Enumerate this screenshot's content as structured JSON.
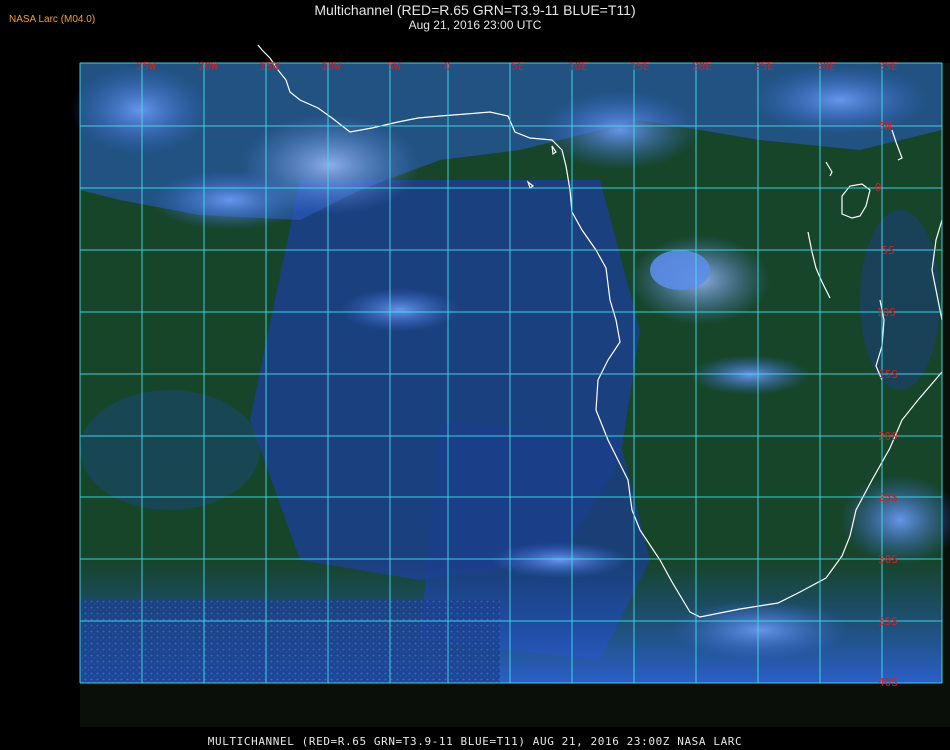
{
  "header": {
    "producer": "NASA Larc (M04.0)",
    "title": "Multichannel (RED=R.65 GRN=T3.9-11 BLUE=T11)",
    "datetime": "Aug 21, 2016 23:00 UTC"
  },
  "footer": {
    "caption": "MULTICHANNEL (RED=R.65 GRN=T3.9-11 BLUE=T11) AUG 21, 2016 23:00Z   NASA LARC"
  },
  "map": {
    "longitude_labels": [
      "25W",
      "20W",
      "15W",
      "10W",
      "5W",
      "0",
      "5E",
      "10E",
      "15E",
      "20E",
      "25E",
      "30E",
      "35E"
    ],
    "latitude_labels": [
      "5N",
      "0",
      "5S",
      "10S",
      "15S",
      "20S",
      "25S",
      "30S",
      "35S",
      "40S"
    ],
    "colors": {
      "grid": "#3fe0ee",
      "label": "#d42020",
      "coast": "#ffffff",
      "ocean_dark": "#12402a",
      "ocean_blue": "#1d46a8",
      "cloud_light": "#5a8ce8"
    }
  }
}
